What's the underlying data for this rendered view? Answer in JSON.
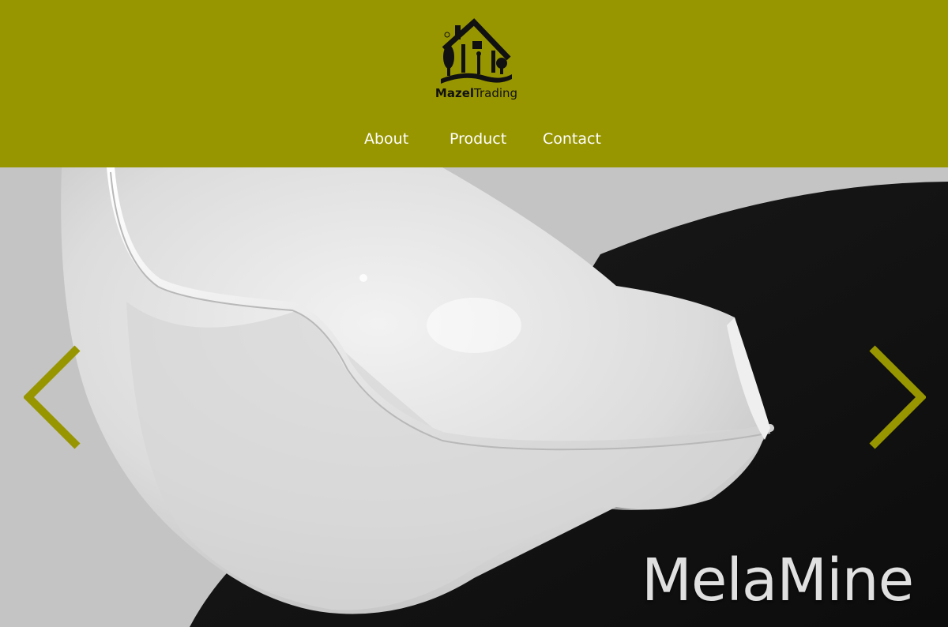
{
  "header": {
    "logo": {
      "brand_bold": "Mazel",
      "brand_regular": "Trading",
      "icon": "house-trees-logo-icon"
    },
    "background_color": "#989600"
  },
  "nav": {
    "items": [
      {
        "label": "About"
      },
      {
        "label": "Product"
      },
      {
        "label": "Contact"
      }
    ]
  },
  "hero": {
    "caption": "MelaMine",
    "prev_icon": "chevron-left-icon",
    "next_icon": "chevron-right-icon",
    "accent_color": "#989600"
  }
}
